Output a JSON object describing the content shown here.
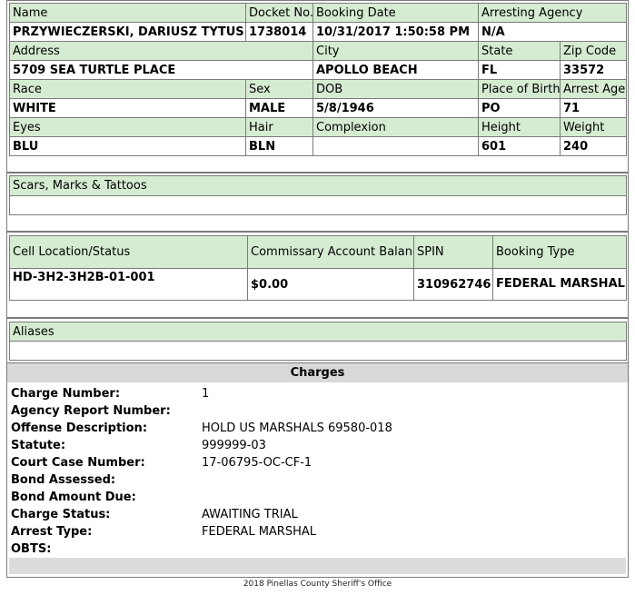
{
  "booking": {
    "name_label": "Name",
    "name": "PRZYWIECZERSKI, DARIUSZ TYTUS",
    "docket_label": "Docket No.",
    "docket": "1738014",
    "booking_date_label": "Booking Date",
    "booking_date": "10/31/2017 1:50:58 PM",
    "agency_label": "Arresting Agency",
    "agency": "N/A",
    "address_label": "Address",
    "address": "5709 SEA TURTLE PLACE",
    "city_label": "City",
    "city": "APOLLO BEACH",
    "state_label": "State",
    "state": "FL",
    "zip_label": "Zip Code",
    "zip": "33572",
    "race_label": "Race",
    "race": "WHITE",
    "sex_label": "Sex",
    "sex": "MALE",
    "dob_label": "DOB",
    "dob": "5/8/1946",
    "pob_label": "Place of Birth",
    "pob": "PO",
    "arrest_age_label": "Arrest Age",
    "arrest_age": "71",
    "eyes_label": "Eyes",
    "eyes": "BLU",
    "hair_label": "Hair",
    "hair": "BLN",
    "complexion_label": "Complexion",
    "complexion": "",
    "height_label": "Height",
    "height": "601",
    "weight_label": "Weight",
    "weight": "240"
  },
  "scars": {
    "label": "Scars, Marks & Tattoos",
    "value": ""
  },
  "cell": {
    "location_label": "Cell Location/Status",
    "location": "HD-3H2-3H2B-01-001",
    "commissary_label": "Commissary Account Balance",
    "commissary": "$0.00",
    "spin_label": "SPIN",
    "spin": "310962746",
    "booking_type_label": "Booking Type",
    "booking_type": "FEDERAL MARSHALL"
  },
  "aliases": {
    "label": "Aliases",
    "value": ""
  },
  "charges": {
    "title": "Charges",
    "rows": [
      {
        "label": "Charge Number:",
        "value": "1"
      },
      {
        "label": "Agency Report Number:",
        "value": ""
      },
      {
        "label": "Offense Description:",
        "value": "HOLD US MARSHALS 69580-018"
      },
      {
        "label": "Statute:",
        "value": "999999-03"
      },
      {
        "label": "Court Case Number:",
        "value": "17-06795-OC-CF-1"
      },
      {
        "label": "Bond Assessed:",
        "value": ""
      },
      {
        "label": "Bond Amount Due:",
        "value": ""
      },
      {
        "label": "Charge Status:",
        "value": "AWAITING TRIAL"
      },
      {
        "label": "Arrest Type:",
        "value": "FEDERAL MARSHAL"
      },
      {
        "label": "OBTS:",
        "value": ""
      }
    ]
  },
  "footer": "2018 Pinellas County Sheriff's Office"
}
